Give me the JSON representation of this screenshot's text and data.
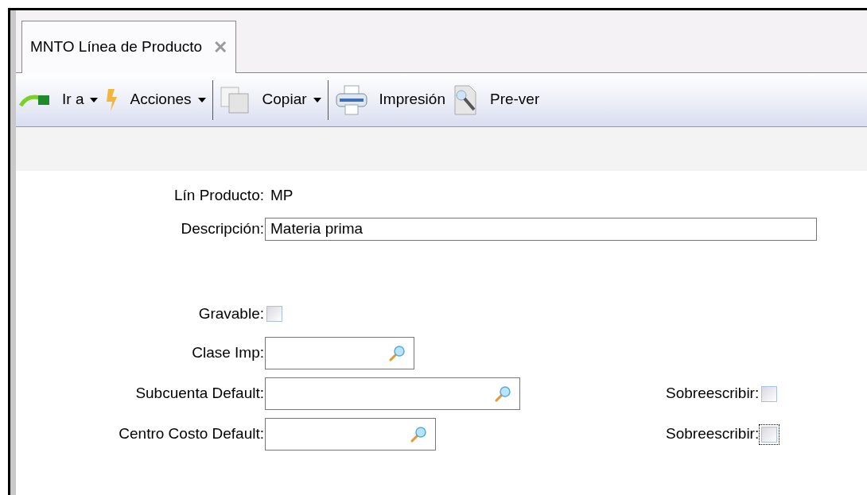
{
  "tabs": [
    {
      "label": "MNTO Línea de Producto",
      "selected": true,
      "close": "✕"
    }
  ],
  "toolbar": [
    {
      "label": "Ir a",
      "dropdown": true,
      "separator_after": false
    },
    {
      "label": "Acciones",
      "dropdown": true,
      "separator_after": true
    },
    {
      "label": "Copiar",
      "dropdown": true,
      "separator_after": true
    },
    {
      "label": "Impresión",
      "dropdown": false,
      "separator_after": false
    },
    {
      "label": "Pre-ver",
      "dropdown": false,
      "separator_after": false
    }
  ],
  "form": [
    {
      "kind": "text",
      "label": "Lín Producto:",
      "value": "MP"
    },
    {
      "kind": "input",
      "label": "Descripción:",
      "value": "Materia prima"
    },
    {
      "kind": "gap"
    },
    {
      "kind": "checkbox",
      "label": "Gravable:",
      "checked": false
    },
    {
      "kind": "lookup",
      "label": "Clase Imp:"
    },
    {
      "kind": "lookup",
      "label": "Subcuenta Default:",
      "override": {
        "label": "Sobreescribir:",
        "checked": false,
        "focused": false
      }
    },
    {
      "kind": "lookup",
      "label": "Centro Costo Default:",
      "override": {
        "label": "Sobreescribir:",
        "checked": false,
        "focused": true
      }
    }
  ]
}
